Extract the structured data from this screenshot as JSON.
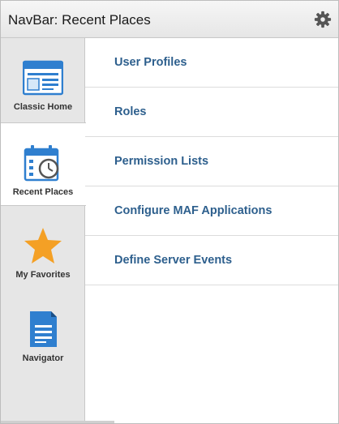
{
  "header": {
    "title": "NavBar: Recent Places",
    "settings_icon": "gear-icon"
  },
  "sidebar": {
    "items": [
      {
        "label": "Classic Home",
        "icon": "classic-home-window-icon",
        "active": false
      },
      {
        "label": "Recent Places",
        "icon": "calendar-clock-icon",
        "active": true
      },
      {
        "label": "My Favorites",
        "icon": "star-icon",
        "active": false
      },
      {
        "label": "Navigator",
        "icon": "document-icon",
        "active": false
      }
    ]
  },
  "recent_places": {
    "items": [
      {
        "label": "User Profiles"
      },
      {
        "label": "Roles"
      },
      {
        "label": "Permission Lists"
      },
      {
        "label": "Configure MAF Applications"
      },
      {
        "label": "Define Server Events"
      }
    ]
  },
  "colors": {
    "link": "#2d5f8d",
    "sidebar_bg": "#e6e6e6",
    "icon_blue": "#2f7fcf",
    "star": "#f4a025"
  }
}
